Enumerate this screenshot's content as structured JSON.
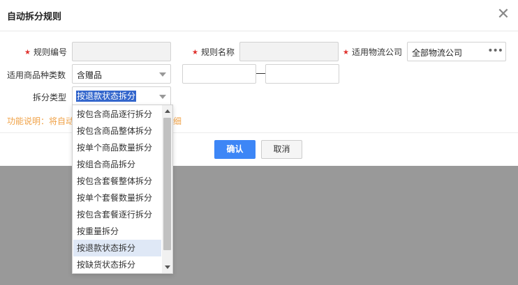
{
  "dialog": {
    "title": "自动拆分规则",
    "close_symbol": "✕"
  },
  "form": {
    "rule_code_label": "规则编号",
    "rule_code_value": "",
    "rule_name_label": "规则名称",
    "rule_name_value": "",
    "carrier_label": "适用物流公司",
    "carrier_value": "全部物流公司",
    "carrier_more": "•••",
    "category_count_label": "适用商品种类数",
    "category_count_value": "含赠品",
    "range_from": "",
    "range_to": "",
    "split_type_label": "拆分类型",
    "split_type_value": "按退款状态拆分",
    "required_mark": "★"
  },
  "note": {
    "visible_start": "功能说明：将自动",
    "visible_end": "细"
  },
  "buttons": {
    "confirm": "确认",
    "cancel": "取消"
  },
  "dropdown": {
    "options": [
      "按包含商品逐行拆分",
      "按包含商品整体拆分",
      "按单个商品数量拆分",
      "按组合商品拆分",
      "按包含套餐整体拆分",
      "按单个套餐数量拆分",
      "按包含套餐逐行拆分",
      "按重量拆分",
      "按退款状态拆分",
      "按缺货状态拆分"
    ],
    "highlighted_option": "按退款状态拆分"
  },
  "colors": {
    "primary": "#3d86f6",
    "required": "#e0312d",
    "note": "#f0a247",
    "overlay": "#999999"
  }
}
